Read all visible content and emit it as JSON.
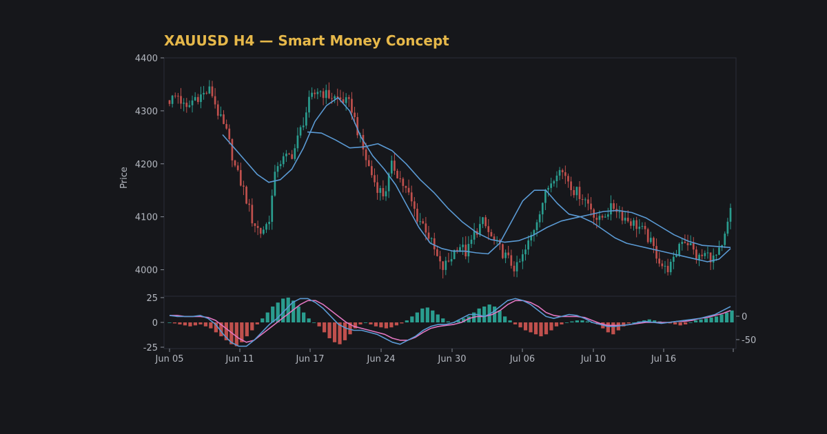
{
  "chart_data": {
    "type": "candlestick",
    "title": "XAUUSD H4 — Smart Money Concept",
    "ylabel": "Price",
    "ylim": [
      3950,
      4400
    ],
    "yticks": [
      4000,
      4100,
      4200,
      4300,
      4400
    ],
    "xticks": [
      "Jun 05",
      "Jun 11",
      "Jun 17",
      "Jun 24",
      "Jun 30",
      "Jul 06",
      "Jul 10",
      "Jul 16"
    ],
    "grid": false,
    "colors": {
      "up": "#2a9d8f",
      "down": "#c0504d",
      "ma": "#5b9bd5",
      "macd": "#5b9bd5",
      "signal": "#e377c2",
      "title": "#e6b84a",
      "background": "#16171b"
    },
    "close_anchors": [
      4320,
      4330,
      4300,
      4325,
      4330,
      4340,
      4290,
      4255,
      4190,
      4150,
      4095,
      4070,
      4090,
      4200,
      4210,
      4220,
      4270,
      4320,
      4340,
      4330,
      4325,
      4320,
      4310,
      4250,
      4200,
      4160,
      4140,
      4200,
      4170,
      4140,
      4100,
      4080,
      4040,
      4000,
      4020,
      4050,
      4030,
      4070,
      4090,
      4060,
      4040,
      4020,
      4000,
      4030,
      4070,
      4120,
      4160,
      4190,
      4180,
      4150,
      4140,
      4120,
      4090,
      4110,
      4120,
      4100,
      4090,
      4080,
      4060,
      4030,
      4000,
      4010,
      4060,
      4050,
      4020,
      4030,
      4020,
      4040,
      4110
    ],
    "candle_count": 198,
    "ma_fast": [
      4255,
      4230,
      4205,
      4180,
      4165,
      4170,
      4190,
      4230,
      4280,
      4310,
      4325,
      4300,
      4250,
      4215,
      4190,
      4160,
      4120,
      4080,
      4050,
      4040,
      4035,
      4035,
      4032,
      4030,
      4050,
      4090,
      4130,
      4150,
      4150,
      4125,
      4105,
      4100,
      4090,
      4075,
      4060,
      4050,
      4045,
      4040,
      4035,
      4030,
      4025,
      4020,
      4015,
      4020,
      4040
    ],
    "ma_slow": [
      4260,
      4258,
      4245,
      4230,
      4232,
      4238,
      4225,
      4200,
      4170,
      4145,
      4115,
      4090,
      4070,
      4057,
      4052,
      4055,
      4065,
      4080,
      4092,
      4098,
      4104,
      4110,
      4112,
      4108,
      4098,
      4082,
      4066,
      4054,
      4046,
      4044,
      4042
    ],
    "macd": {
      "ylim": [
        -25,
        25
      ],
      "yticks": [
        25,
        0,
        -25
      ],
      "right_yticks": [
        0,
        -50
      ],
      "histogram": [
        0,
        -1,
        -2,
        -3,
        -4,
        -3,
        -2,
        -4,
        -6,
        -10,
        -14,
        -18,
        -22,
        -24,
        -20,
        -14,
        -8,
        -2,
        4,
        10,
        16,
        20,
        24,
        25,
        22,
        16,
        10,
        4,
        0,
        -4,
        -10,
        -16,
        -20,
        -22,
        -18,
        -12,
        -6,
        -2,
        0,
        -2,
        -4,
        -5,
        -6,
        -5,
        -3,
        -1,
        2,
        6,
        10,
        14,
        15,
        12,
        8,
        4,
        1,
        0,
        2,
        4,
        6,
        10,
        14,
        16,
        18,
        16,
        12,
        6,
        2,
        -2,
        -5,
        -8,
        -10,
        -12,
        -14,
        -12,
        -8,
        -4,
        -2,
        0,
        1,
        2,
        2,
        1,
        0,
        -2,
        -6,
        -10,
        -12,
        -8,
        -4,
        -1,
        0,
        1,
        2,
        3,
        2,
        1,
        0,
        -1,
        -2,
        -3,
        -2,
        0,
        2,
        3,
        4,
        5,
        6,
        8,
        10,
        12
      ],
      "macd_line": [
        7,
        6,
        6,
        6,
        7,
        4,
        -2,
        -12,
        -20,
        -24,
        -24,
        -18,
        -10,
        -2,
        4,
        12,
        20,
        24,
        24,
        20,
        14,
        6,
        -2,
        -6,
        -8,
        -8,
        -10,
        -12,
        -16,
        -20,
        -22,
        -18,
        -14,
        -8,
        -4,
        -2,
        -2,
        0,
        4,
        8,
        8,
        6,
        10,
        16,
        22,
        24,
        22,
        18,
        12,
        6,
        4,
        6,
        8,
        7,
        4,
        0,
        -2,
        -4,
        -4,
        -3,
        -2,
        0,
        1,
        0,
        -1,
        0,
        1,
        2,
        3,
        4,
        6,
        8,
        12,
        16
      ],
      "signal_line": [
        7,
        7,
        6,
        6,
        6,
        5,
        2,
        -4,
        -10,
        -16,
        -20,
        -18,
        -12,
        -6,
        0,
        6,
        12,
        18,
        22,
        22,
        18,
        12,
        6,
        0,
        -4,
        -6,
        -8,
        -10,
        -12,
        -16,
        -18,
        -18,
        -15,
        -10,
        -6,
        -4,
        -3,
        -2,
        0,
        4,
        6,
        6,
        8,
        12,
        18,
        22,
        22,
        20,
        16,
        10,
        7,
        6,
        6,
        6,
        5,
        2,
        -1,
        -3,
        -3,
        -3,
        -2,
        -1,
        0,
        0,
        0,
        0,
        1,
        1,
        2,
        4,
        5,
        7,
        9,
        12
      ]
    }
  }
}
